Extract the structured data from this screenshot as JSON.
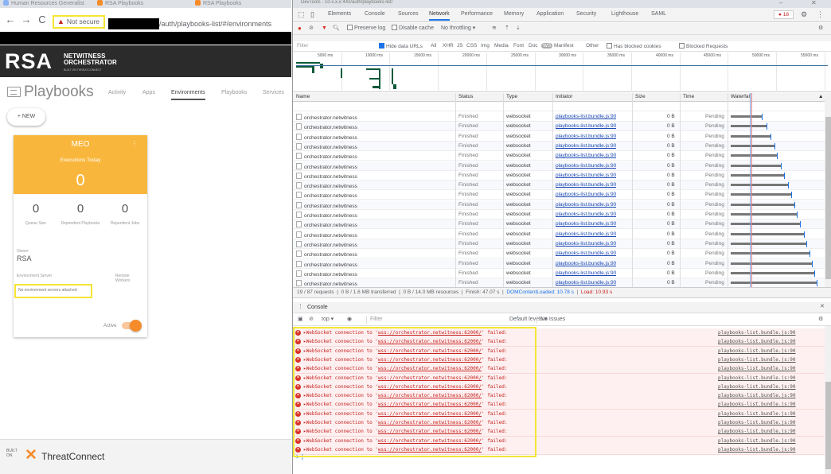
{
  "browser": {
    "tabs": [
      "Human Resources Generalist",
      "RSA Playbooks",
      "RSA Playbooks"
    ],
    "not_secure_label": "Not secure",
    "url_suffix": "/auth/playbooks-list/#/environments"
  },
  "app": {
    "logo_text": "RSA",
    "product_line1": "NETWITNESS",
    "product_line2": "ORCHESTRATOR",
    "product_small": "BUILT ON THREATCONNECT",
    "title": "Playbooks",
    "nav": [
      {
        "label": "Activity",
        "active": false
      },
      {
        "label": "Apps",
        "active": false
      },
      {
        "label": "Environments",
        "active": true
      },
      {
        "label": "Playbooks",
        "active": false
      },
      {
        "label": "Services",
        "active": false
      }
    ],
    "new_button": "+ NEW",
    "card": {
      "name": "MEO",
      "executions_label": "Executions Today",
      "executions_count": "0",
      "stats": [
        {
          "value": "0",
          "label": "Queue Size"
        },
        {
          "value": "0",
          "label": "Dependent Playbooks"
        },
        {
          "value": "0",
          "label": "Dependent Jobs"
        }
      ],
      "owner_label": "Owner",
      "owner_value": "RSA",
      "env_server_label": "Environment Server",
      "remote_workers_label": "Remote Workers",
      "env_note": "No environment servers attached",
      "active_label": "Active",
      "active": true
    },
    "footer_built": "BUILT ON",
    "footer_brand": "ThreatConnect"
  },
  "devtools": {
    "window_title": "DevTools - 10.x.x.x:443/auth/playbooks-list/",
    "tabs": [
      {
        "label": "Elements",
        "active": false
      },
      {
        "label": "Console",
        "active": false
      },
      {
        "label": "Sources",
        "active": false
      },
      {
        "label": "Network",
        "active": true
      },
      {
        "label": "Performance",
        "active": false
      },
      {
        "label": "Memory",
        "active": false
      },
      {
        "label": "Application",
        "active": false
      },
      {
        "label": "Security",
        "active": false
      },
      {
        "label": "Lighthouse",
        "active": false
      },
      {
        "label": "SAML",
        "active": false
      }
    ],
    "error_count": "18",
    "toolbar": {
      "preserve_log": "Preserve log",
      "disable_cache": "Disable cache",
      "throttling": "No throttling"
    },
    "filter": {
      "placeholder": "Filter",
      "hide_data_urls": "Hide data URLs",
      "types": [
        "All",
        "XHR",
        "JS",
        "CSS",
        "Img",
        "Media",
        "Font",
        "Doc",
        "WS",
        "Manifest",
        "Other"
      ],
      "blocked_cookies": "Has blocked cookies",
      "blocked_requests": "Blocked Requests"
    },
    "overview_ticks": [
      "5000 ms",
      "10000 ms",
      "15000 ms",
      "20000 ms",
      "25000 ms",
      "30000 ms",
      "35000 ms",
      "40000 ms",
      "45000 ms",
      "50000 ms",
      "55000 ms"
    ],
    "columns": [
      "Name",
      "Status",
      "Type",
      "Initiator",
      "Size",
      "Time",
      "Waterfall"
    ],
    "rows": [
      {
        "name": "orchestrator.netwitness",
        "status": "Finished",
        "type": "websocket",
        "initiator": "playbooks-list.bundle.js:90",
        "size": "0 B",
        "time": "Pending",
        "wf": 0.35
      },
      {
        "name": "orchestrator.netwitness",
        "status": "Finished",
        "type": "websocket",
        "initiator": "playbooks-list.bundle.js:90",
        "size": "0 B",
        "time": "Pending",
        "wf": 0.4
      },
      {
        "name": "orchestrator.netwitness",
        "status": "Finished",
        "type": "websocket",
        "initiator": "playbooks-list.bundle.js:90",
        "size": "0 B",
        "time": "Pending",
        "wf": 0.45
      },
      {
        "name": "orchestrator.netwitness",
        "status": "Finished",
        "type": "websocket",
        "initiator": "playbooks-list.bundle.js:90",
        "size": "0 B",
        "time": "Pending",
        "wf": 0.49
      },
      {
        "name": "orchestrator.netwitness",
        "status": "Finished",
        "type": "websocket",
        "initiator": "playbooks-list.bundle.js:90",
        "size": "0 B",
        "time": "Pending",
        "wf": 0.52
      },
      {
        "name": "orchestrator.netwitness",
        "status": "Finished",
        "type": "websocket",
        "initiator": "playbooks-list.bundle.js:90",
        "size": "0 B",
        "time": "Pending",
        "wf": 0.56
      },
      {
        "name": "orchestrator.netwitness",
        "status": "Finished",
        "type": "websocket",
        "initiator": "playbooks-list.bundle.js:90",
        "size": "0 B",
        "time": "Pending",
        "wf": 0.6
      },
      {
        "name": "orchestrator.netwitness",
        "status": "Finished",
        "type": "websocket",
        "initiator": "playbooks-list.bundle.js:90",
        "size": "0 B",
        "time": "Pending",
        "wf": 0.64
      },
      {
        "name": "orchestrator.netwitness",
        "status": "Finished",
        "type": "websocket",
        "initiator": "playbooks-list.bundle.js:90",
        "size": "0 B",
        "time": "Pending",
        "wf": 0.68
      },
      {
        "name": "orchestrator.netwitness",
        "status": "Finished",
        "type": "websocket",
        "initiator": "playbooks-list.bundle.js:90",
        "size": "0 B",
        "time": "Pending",
        "wf": 0.71
      },
      {
        "name": "orchestrator.netwitness",
        "status": "Finished",
        "type": "websocket",
        "initiator": "playbooks-list.bundle.js:90",
        "size": "0 B",
        "time": "Pending",
        "wf": 0.74
      },
      {
        "name": "orchestrator.netwitness",
        "status": "Finished",
        "type": "websocket",
        "initiator": "playbooks-list.bundle.js:90",
        "size": "0 B",
        "time": "Pending",
        "wf": 0.78
      },
      {
        "name": "orchestrator.netwitness",
        "status": "Finished",
        "type": "websocket",
        "initiator": "playbooks-list.bundle.js:90",
        "size": "0 B",
        "time": "Pending",
        "wf": 0.82
      },
      {
        "name": "orchestrator.netwitness",
        "status": "Finished",
        "type": "websocket",
        "initiator": "playbooks-list.bundle.js:90",
        "size": "0 B",
        "time": "Pending",
        "wf": 0.85
      },
      {
        "name": "orchestrator.netwitness",
        "status": "Finished",
        "type": "websocket",
        "initiator": "playbooks-list.bundle.js:90",
        "size": "0 B",
        "time": "Pending",
        "wf": 0.88
      },
      {
        "name": "orchestrator.netwitness",
        "status": "Finished",
        "type": "websocket",
        "initiator": "playbooks-list.bundle.js:90",
        "size": "0 B",
        "time": "Pending",
        "wf": 0.91
      },
      {
        "name": "orchestrator.netwitness",
        "status": "Finished",
        "type": "websocket",
        "initiator": "playbooks-list.bundle.js:90",
        "size": "0 B",
        "time": "Pending",
        "wf": 0.94
      },
      {
        "name": "orchestrator.netwitness",
        "status": "Finished",
        "type": "websocket",
        "initiator": "playbooks-list.bundle.js:90",
        "size": "0 B",
        "time": "Pending",
        "wf": 0.96
      },
      {
        "name": "instantNotification",
        "status": "101",
        "type": "websocket",
        "initiator": "main-menu.bundle.js:85",
        "size": "0 B",
        "time": "Pending",
        "wf": 1.0
      }
    ],
    "summary": {
      "requests": "19 / 87 requests",
      "transferred": "0 B / 1.6 MB transferred",
      "resources": "0 B / 14.0 MB resources",
      "finish": "Finish: 47.07 s",
      "dcl": "DOMContentLoaded: 10.78 s",
      "load": "Load: 10.93 s"
    },
    "console": {
      "title": "Console",
      "context": "top",
      "filter_placeholder": "Filter",
      "levels": "Default levels",
      "issues": "No Issues",
      "message_prefix": "▸WebSocket connection to '",
      "message_url": "wss://orchestrator.netwitness:62000/",
      "message_suffix": "' failed:",
      "source": "playbooks-list.bundle.js:90",
      "count": 14,
      "prompt": ">"
    }
  }
}
